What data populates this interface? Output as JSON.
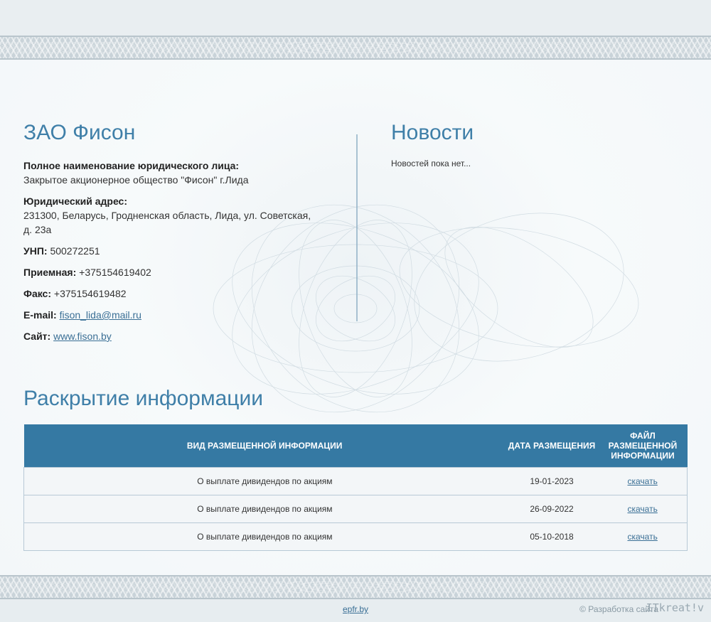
{
  "company": {
    "title": "ЗАО Фисон",
    "fields": [
      {
        "label": "Полное наименование юридического лица:",
        "value": "Закрытое акционерное общество \"Фисон\" г.Лида"
      },
      {
        "label": "Юридический адрес:",
        "value": "231300, Беларусь, Гродненская область, Лида, ул. Советская, д. 23а"
      },
      {
        "label": "УНП:",
        "value": "500272251"
      },
      {
        "label": "Приемная:",
        "value": "+375154619402"
      },
      {
        "label": "Факс:",
        "value": "+375154619482"
      },
      {
        "label": "E-mail:",
        "value": "fison_lida@mail.ru"
      },
      {
        "label": "Сайт:",
        "value": "www.fison.by"
      }
    ]
  },
  "news": {
    "title": "Новости",
    "empty_text": "Новостей пока нет..."
  },
  "disclosure": {
    "title": "Раскрытие информации",
    "headers": [
      "ВИД РАЗМЕЩЕННОЙ ИНФОРМАЦИИ",
      "ДАТА РАЗМЕЩЕНИЯ",
      "ФАЙЛ РАЗМЕЩЕННОЙ ИНФОРМАЦИИ"
    ],
    "rows": [
      {
        "type": "О выплате дивидендов по акциям",
        "date": "19-01-2023",
        "file": "скачать"
      },
      {
        "type": "О выплате дивидендов по акциям",
        "date": "26-09-2022",
        "file": "скачать"
      },
      {
        "type": "О выплате дивидендов по акциям",
        "date": "05-10-2018",
        "file": "скачать"
      }
    ]
  },
  "footer": {
    "link": "epfr.by",
    "copyright": "© Разработка сайта",
    "logo": "ITkreat!v"
  },
  "colors": {
    "accent": "#3f7fa8",
    "table_header": "#3579a3",
    "link": "#3a6f95"
  }
}
